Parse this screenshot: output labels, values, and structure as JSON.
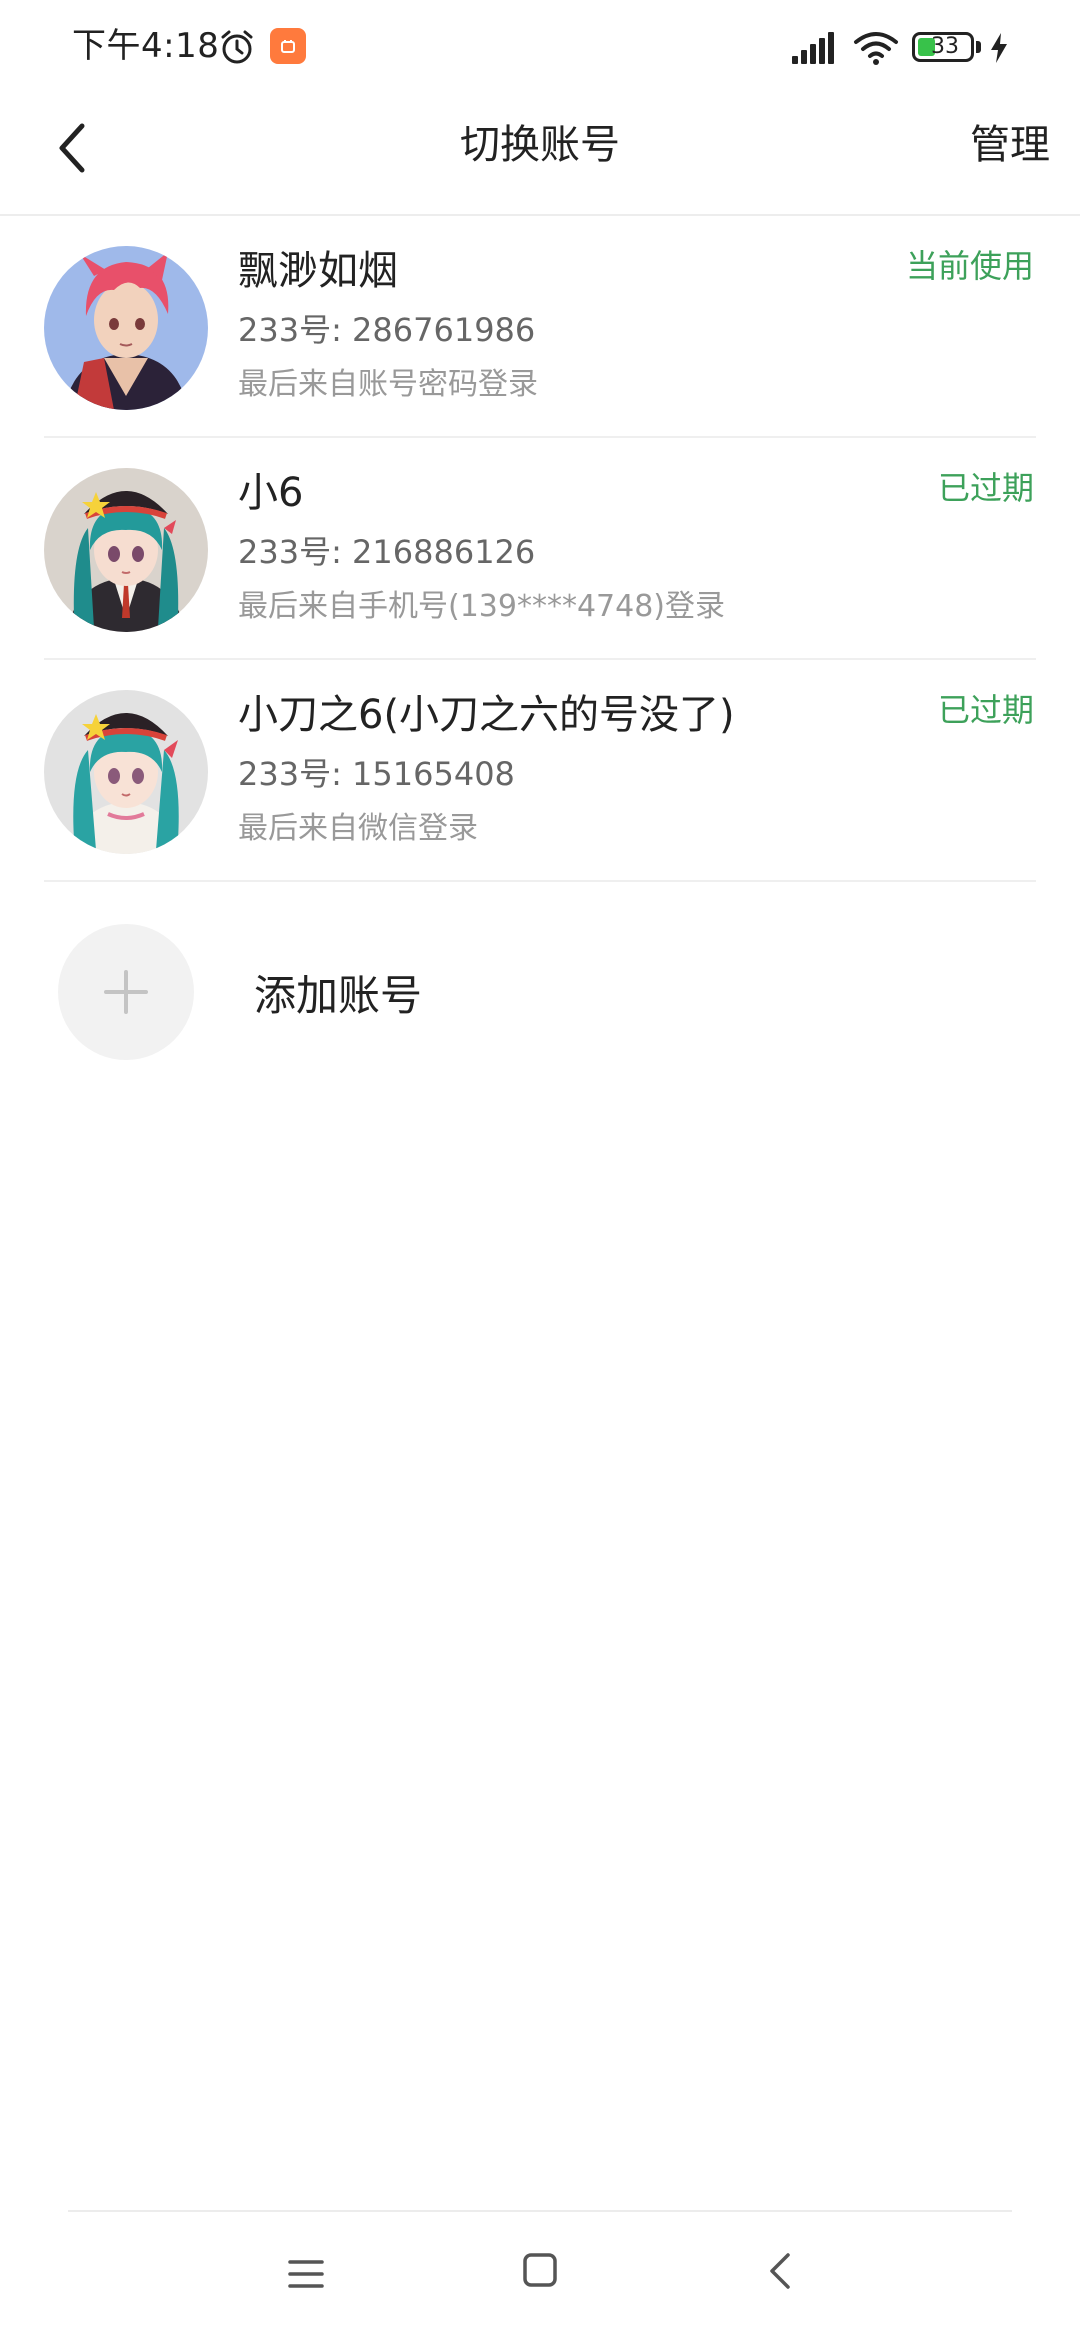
{
  "status_bar": {
    "time": "下午4:18",
    "battery_level": "33",
    "battery_fraction": 0.33,
    "icons": [
      "alarm-icon",
      "app-notification-icon",
      "signal-icon",
      "wifi-icon",
      "battery-icon",
      "charging-icon"
    ]
  },
  "header": {
    "title": "切换账号",
    "manage_label": "管理",
    "back_icon": "back-arrow-icon"
  },
  "accounts": [
    {
      "name": "飘渺如烟",
      "id_text": "233号: 286761986",
      "login_text": "最后来自账号密码登录",
      "status": "当前使用",
      "avatar": "red-haired-character-avatar"
    },
    {
      "name": "小6",
      "id_text": "233号: 216886126",
      "login_text": "最后来自手机号(139****4748)登录",
      "status": "已过期",
      "avatar": "teal-haired-character-avatar"
    },
    {
      "name": "小刀之6(小刀之六的号没了)",
      "id_text": "233号: 15165408",
      "login_text": "最后来自微信登录",
      "status": "已过期",
      "avatar": "teal-haired-character-avatar"
    }
  ],
  "add_account": {
    "label": "添加账号",
    "icon": "plus-icon"
  },
  "colors": {
    "status_green": "#3da15a",
    "text_primary": "#222222",
    "text_secondary": "#666666",
    "text_tertiary": "#999999"
  },
  "nav": {
    "icons": [
      "menu-icon",
      "home-icon",
      "back-icon"
    ]
  }
}
